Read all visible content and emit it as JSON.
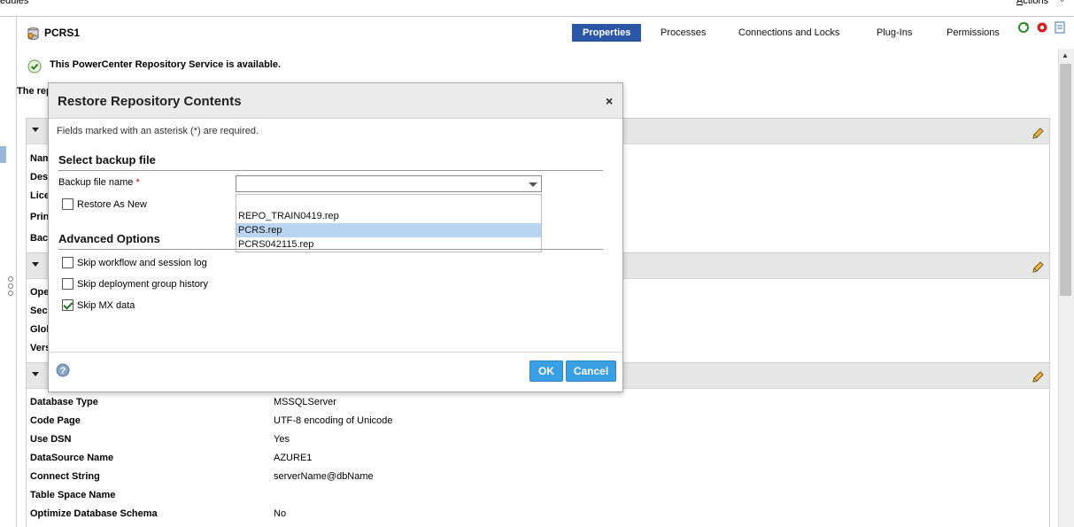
{
  "topbar": {
    "left_text": "edules",
    "actions_label": "Actions",
    "actions_accel": "A"
  },
  "service": {
    "title": "PCRS1",
    "icon": "repository-service-icon"
  },
  "tabs": [
    {
      "label": "Properties",
      "active": true
    },
    {
      "label": "Processes",
      "active": false
    },
    {
      "label": "Connections and Locks",
      "active": false
    },
    {
      "label": "Plug-Ins",
      "active": false
    },
    {
      "label": "Permissions",
      "active": false
    }
  ],
  "status": {
    "message": "This PowerCenter Repository Service is available.",
    "icon": "check-circle-icon",
    "truncated_text": "The rep"
  },
  "background_labels": {
    "section1_rows": [
      "Nam",
      "Des",
      "Lice",
      "Prin",
      "Bac"
    ],
    "section2_rows": [
      "Ope",
      "Secu",
      "Glob",
      "Vers"
    ]
  },
  "database_properties": [
    {
      "label": "Database Type",
      "value": "MSSQLServer"
    },
    {
      "label": "Code Page",
      "value": "UTF-8 encoding of Unicode"
    },
    {
      "label": "Use DSN",
      "value": "Yes"
    },
    {
      "label": "DataSource Name",
      "value": "AZURE1"
    },
    {
      "label": "Connect String",
      "value": "serverName@dbName"
    },
    {
      "label": "Table Space Name",
      "value": ""
    },
    {
      "label": "Optimize Database Schema",
      "value": "No"
    }
  ],
  "modal": {
    "title": "Restore Repository Contents",
    "close_glyph": "×",
    "required_note": "Fields marked with an asterisk (*) are required.",
    "select_backup_title": "Select backup file",
    "backup_file_label": "Backup file name",
    "required_mark": "*",
    "backup_file_value": "",
    "backup_options": [
      "REPO_TRAIN0419.rep",
      "PCRS.rep",
      "PCRS042115.rep"
    ],
    "highlighted_option": "PCRS.rep",
    "restore_as_new": {
      "label": "Restore As New",
      "checked": false
    },
    "advanced_title": "Advanced Options",
    "advanced_options": [
      {
        "label": "Skip workflow and session log",
        "checked": false
      },
      {
        "label": "Skip deployment group history",
        "checked": false
      },
      {
        "label": "Skip MX data",
        "checked": true
      }
    ],
    "ok_label": "OK",
    "cancel_label": "Cancel"
  },
  "colors": {
    "active_tab": "#2b56a3",
    "button_primary": "#3aa0e3",
    "section_bar": "#e6e6e6",
    "list_highlight": "#b9d4ee"
  }
}
